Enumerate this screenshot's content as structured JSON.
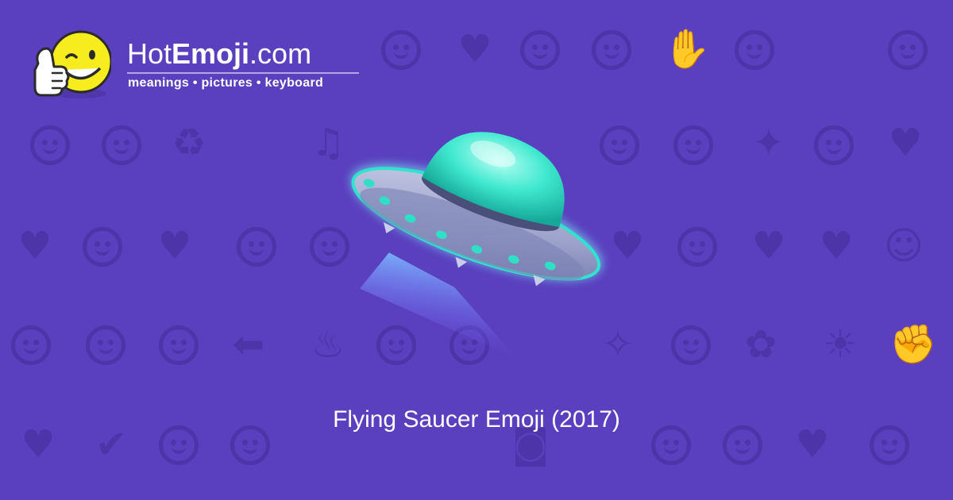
{
  "brand": {
    "name_prefix": "Hot",
    "name_bold": "Emoji",
    "name_suffix": ".com",
    "tagline": "meanings • pictures • keyboard"
  },
  "caption": "Flying Saucer Emoji (2017)",
  "emoji": {
    "icon": "flying-saucer-icon",
    "colors": {
      "dome": "#3fe8cf",
      "hull": "#9aa0c9",
      "lights": "#2ee0c8",
      "beam": "#6fb0ff"
    }
  },
  "background": {
    "color": "#5a3fbe",
    "pattern_color": "#4d34a8",
    "pattern_icons": [
      "smiley-icon",
      "heart-icon",
      "recycle-icon",
      "music-note-icon",
      "sparkles-icon",
      "broken-heart-icon",
      "arrow-left-icon",
      "fire-icon",
      "rose-icon",
      "sun-icon",
      "check-icon",
      "monkey-icon",
      "flexed-arm-icon",
      "camera-icon",
      "party-popper-icon"
    ]
  }
}
